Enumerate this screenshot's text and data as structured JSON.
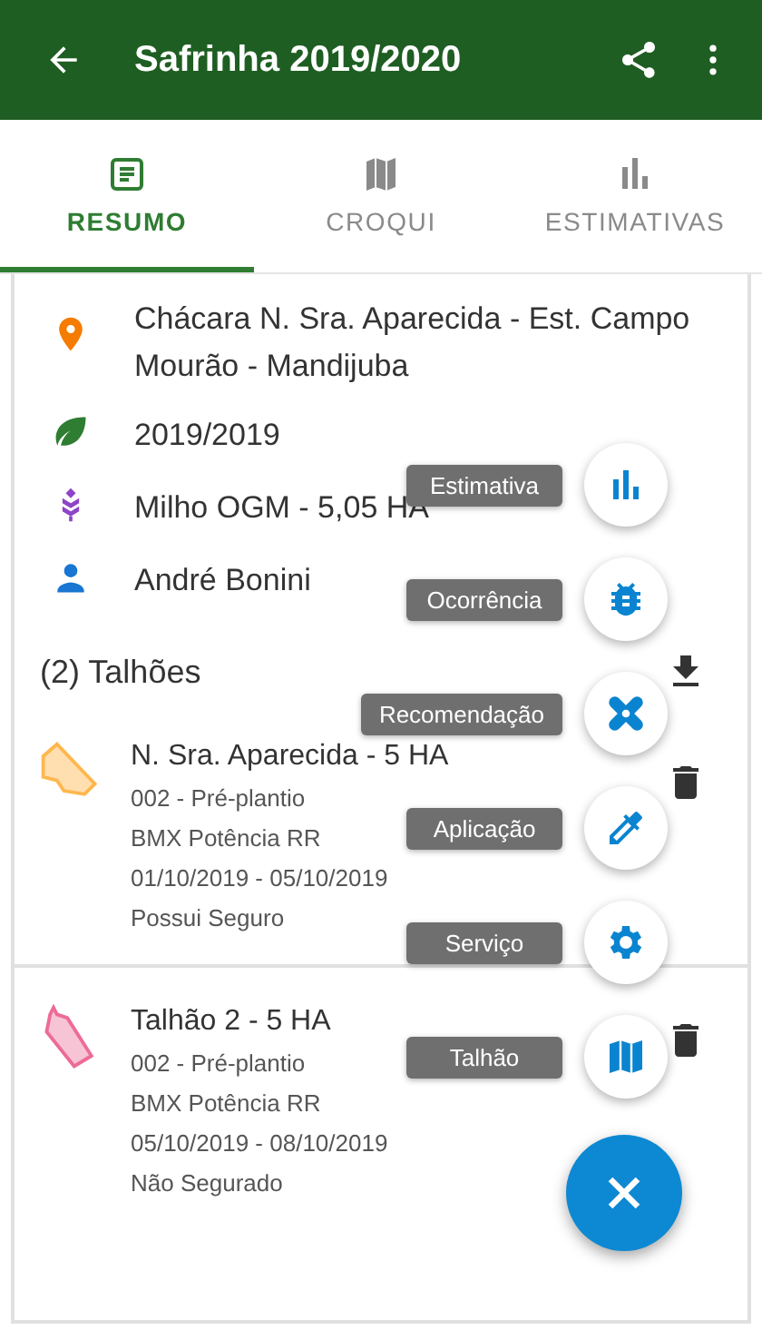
{
  "app_bar": {
    "title": "Safrinha 2019/2020"
  },
  "tabs": [
    {
      "label": "RESUMO",
      "selected": true,
      "kind": "summary"
    },
    {
      "label": "CROQUI",
      "selected": false,
      "kind": "map"
    },
    {
      "label": "ESTIMATIVAS",
      "selected": false,
      "kind": "chart"
    }
  ],
  "summary": [
    {
      "kind": "location",
      "text": "Chácara N. Sra. Aparecida - Est. Campo Mourão - Mandijuba"
    },
    {
      "kind": "season",
      "text": "2019/2019"
    },
    {
      "kind": "crop",
      "text": "Milho OGM - 5,05 HA"
    },
    {
      "kind": "person",
      "text": "André Bonini"
    }
  ],
  "fields_header": "(2) Talhões",
  "fields": [
    {
      "name": "N. Sra. Aparecida - 5 HA",
      "color": "#ffb74d",
      "details": [
        "002 - Pré-plantio",
        "BMX Potência RR",
        "01/10/2019 - 05/10/2019",
        "Possui Seguro"
      ]
    },
    {
      "name": "Talhão 2 - 5 HA",
      "color": "#ec6c96",
      "details": [
        "002 - Pré-plantio",
        "BMX Potência RR",
        "05/10/2019 - 08/10/2019",
        "Não Segurado"
      ]
    }
  ],
  "speed_dial": [
    {
      "label": "Estimativa",
      "kind": "chart"
    },
    {
      "label": "Ocorrência",
      "kind": "bug"
    },
    {
      "label": "Recomendação",
      "kind": "bandage"
    },
    {
      "label": "Aplicação",
      "kind": "dropper"
    },
    {
      "label": "Serviço",
      "kind": "gear"
    },
    {
      "label": "Talhão",
      "kind": "map"
    }
  ]
}
